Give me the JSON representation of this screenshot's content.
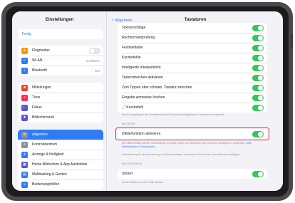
{
  "sidebar": {
    "title": "Einstellungen",
    "profile_link": "Fertig",
    "group1": [
      {
        "label": "Flugmodus",
        "icon": "airplane-icon",
        "color": "#ff9500",
        "value": ""
      },
      {
        "label": "WLAN",
        "icon": "wifi-icon",
        "color": "#2f7cf6",
        "value": "nicWERK"
      },
      {
        "label": "Bluetooth",
        "icon": "bluetooth-icon",
        "color": "#2f7cf6",
        "value": "Ein"
      }
    ],
    "group2": [
      {
        "label": "Mitteilungen",
        "icon": "notifications-icon",
        "color": "#ff3b30"
      },
      {
        "label": "Töne",
        "icon": "sounds-icon",
        "color": "#ff2d55"
      },
      {
        "label": "Fokus",
        "icon": "focus-icon",
        "color": "#5856d6"
      },
      {
        "label": "Bildschirmzeit",
        "icon": "screen-time-icon",
        "color": "#5856d6"
      }
    ],
    "group3": [
      {
        "label": "Allgemein",
        "icon": "gear-icon",
        "color": "#8e8e93",
        "active": true
      },
      {
        "label": "Kontrollzentrum",
        "icon": "control-center-icon",
        "color": "#8e8e93"
      },
      {
        "label": "Anzeige & Helligkeit",
        "icon": "display-icon",
        "color": "#2f7cf6"
      },
      {
        "label": "Home-Bildschirm & App-Mediathek",
        "icon": "home-screen-icon",
        "color": "#5856d6"
      },
      {
        "label": "Multitasking & Gesten",
        "icon": "multitasking-icon",
        "color": "#2f7cf6"
      },
      {
        "label": "Bedienungshilfen",
        "icon": "accessibility-icon",
        "color": "#2f7cf6"
      }
    ]
  },
  "detail": {
    "back_label": "Allgemein",
    "title": "Tastaturen",
    "rows": [
      {
        "label": "Textvorschläge"
      },
      {
        "label": "Rechtschreibprüfung"
      },
      {
        "label": "Feststelltaste"
      },
      {
        "label": "Kurzbefehle"
      },
      {
        "label": "Intelligente Interpunktion"
      },
      {
        "label": "Tastenstreichen aktivieren"
      },
      {
        "label": "Zum Tippen über schweb. Tastatur streichen"
      },
      {
        "label": "Eingabe wortweise löschen"
      },
      {
        "label": "„.“-Kurzbefehl"
      }
    ],
    "period_footer": "Durch Doppeltippen der Leertaste wird ein Punkt mit nachfolgendem Leerzeichen eingesetzt.",
    "dictation_header": "DIKTIEREN",
    "dictation_label": "Diktierfunktion aktivieren",
    "dictation_footer_1": "Die Diktierfunktion sendet Informationen an Apple, wenn sie erforderlich sind, um deine Anfragen zu verarbeiten.",
    "dictation_footer_link": "Über Diktierfunktion & Datenschutz …",
    "dictation_footer_2": "Unterstützung für die Verarbeitung von Sprachanfragen auf deinem iPad ist auch ohne Netzwerk verfügbar.",
    "emoji_header": "EMOJI-SYMBOLE",
    "sticker_label": "Sticker",
    "sticker_footer": "Sende Sticker von der Emoji-Tastatur."
  }
}
